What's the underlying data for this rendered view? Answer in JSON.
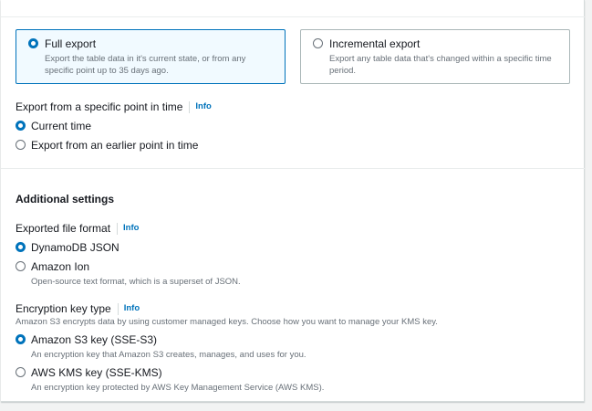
{
  "export_type": {
    "full": {
      "title": "Full export",
      "description": "Export the table data in it's current state, or from any specific point up to 35 days ago.",
      "selected": true
    },
    "incremental": {
      "title": "Incremental export",
      "description": "Export any table data that's changed within a specific time period.",
      "selected": false
    }
  },
  "point_in_time": {
    "label": "Export from a specific point in time",
    "info": "Info",
    "options": [
      {
        "label": "Current time",
        "selected": true
      },
      {
        "label": "Export from an earlier point in time",
        "selected": false
      }
    ]
  },
  "additional_settings": {
    "title": "Additional settings",
    "file_format": {
      "label": "Exported file format",
      "info": "Info",
      "options": [
        {
          "label": "DynamoDB JSON",
          "description": "",
          "selected": true
        },
        {
          "label": "Amazon Ion",
          "description": "Open-source text format, which is a superset of JSON.",
          "selected": false
        }
      ]
    },
    "encryption": {
      "label": "Encryption key type",
      "info": "Info",
      "description": "Amazon S3 encrypts data by using customer managed keys. Choose how you want to manage your KMS key.",
      "options": [
        {
          "label": "Amazon S3 key (SSE-S3)",
          "description": "An encryption key that Amazon S3 creates, manages, and uses for you.",
          "selected": true
        },
        {
          "label": "AWS KMS key (SSE-KMS)",
          "description": "An encryption key protected by AWS Key Management Service (AWS KMS).",
          "selected": false
        }
      ]
    }
  },
  "colors": {
    "accent": "#0073bb",
    "text": "#16191f",
    "muted": "#687078",
    "selected_tile_bg": "#f1faff"
  }
}
